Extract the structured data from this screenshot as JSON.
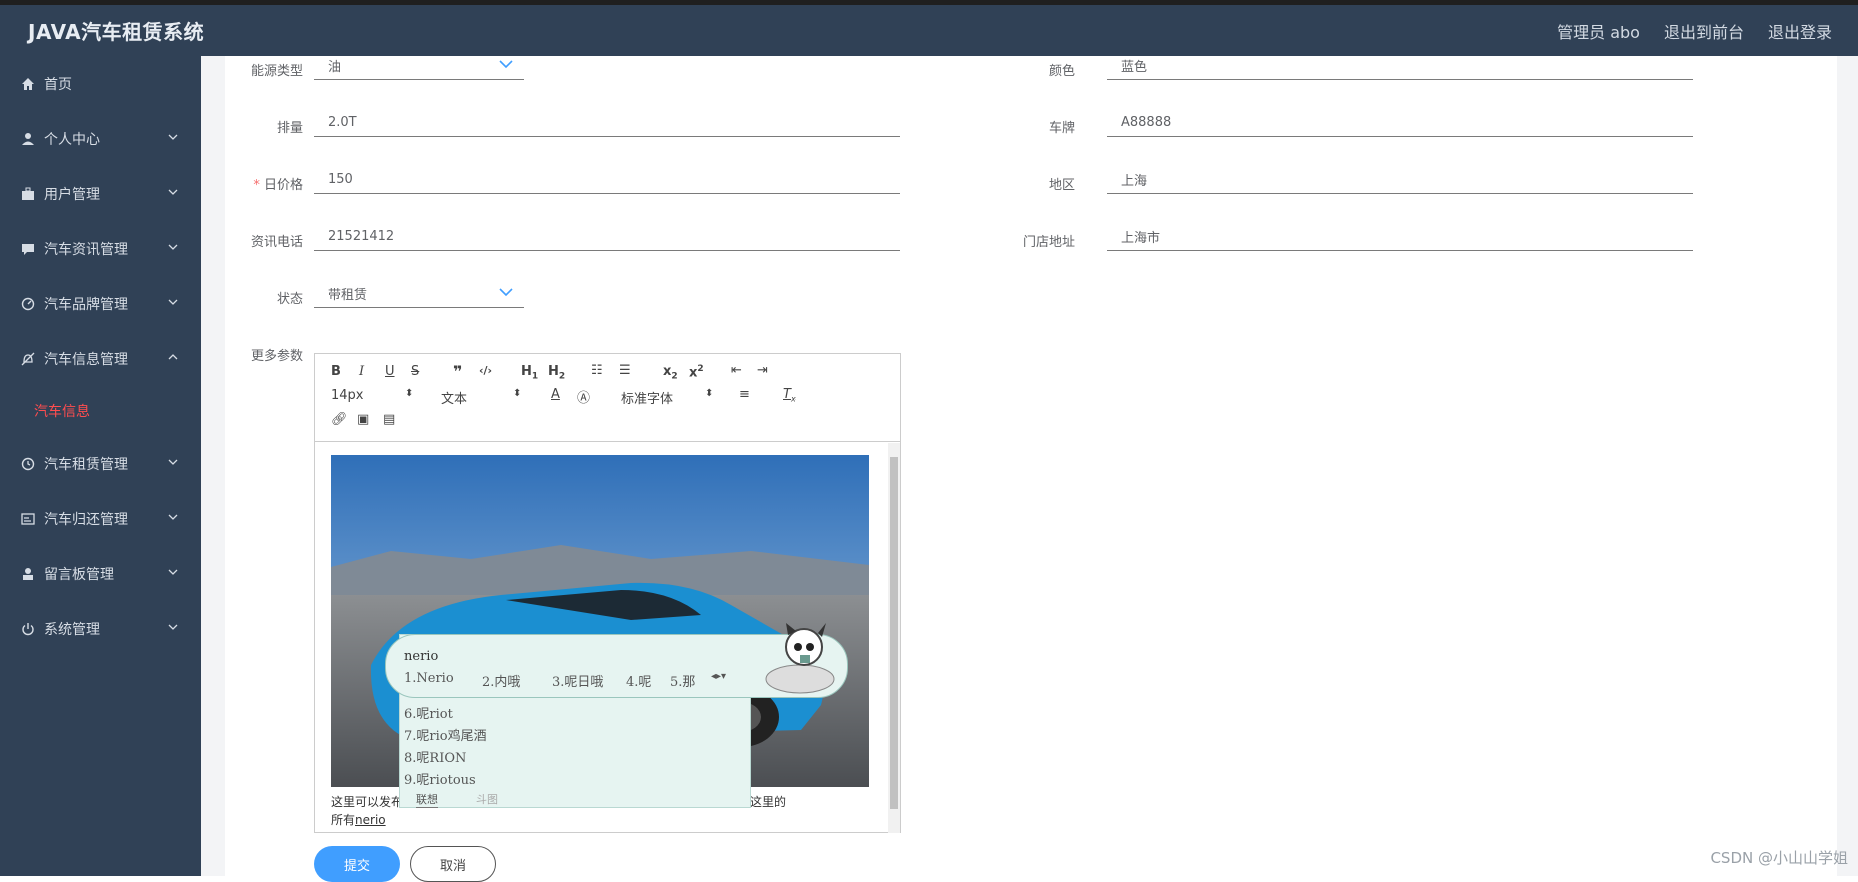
{
  "app": {
    "title": "JAVA汽车租赁系统",
    "header_links": [
      "管理员 abo",
      "退出到前台",
      "退出登录"
    ]
  },
  "sidebar": {
    "items": [
      {
        "label": "首页",
        "icon": "home-icon"
      },
      {
        "label": "个人中心",
        "icon": "user-icon"
      },
      {
        "label": "用户管理",
        "icon": "briefcase-icon"
      },
      {
        "label": "汽车资讯管理",
        "icon": "chat-icon"
      },
      {
        "label": "汽车品牌管理",
        "icon": "gauge-icon"
      },
      {
        "label": "汽车信息管理",
        "icon": "bell-off-icon"
      },
      {
        "label": "汽车租赁管理",
        "icon": "clock-icon"
      },
      {
        "label": "汽车归还管理",
        "icon": "card-icon"
      },
      {
        "label": "留言板管理",
        "icon": "person-icon"
      },
      {
        "label": "系统管理",
        "icon": "power-icon"
      }
    ],
    "active_submenu": "汽车信息"
  },
  "form": {
    "energy_label": "能源类型",
    "energy_value": "油",
    "color_label": "颜色",
    "color_value": "蓝色",
    "displacement_label": "排量",
    "displacement_value": "2.0T",
    "plate_label": "车牌",
    "plate_value": "A88888",
    "price_label": "日价格",
    "price_required": "*",
    "price_value": "150",
    "region_label": "地区",
    "region_value": "上海",
    "phone_label": "资讯电话",
    "phone_value": "21521412",
    "store_label": "门店地址",
    "store_value": "上海市",
    "status_label": "状态",
    "status_value": "带租赁",
    "more_label": "更多参数"
  },
  "editor": {
    "font_size": "14px",
    "paragraph": "文本",
    "font_family": "标准字体",
    "body_line1": "这里可以发布",
    "body_line1_end": "适合描述的，这里的",
    "body_line2": "所有",
    "body_typed": "nerio"
  },
  "ime": {
    "input": "nerio",
    "candidates_row": [
      "1.Nerio",
      "2.内哦",
      "3.呢日哦",
      "4.呢",
      "5.那"
    ],
    "candidates_list": [
      "6.呢riot",
      "7.呢rio鸡尾酒",
      "8.呢RION",
      "9.呢riotous"
    ],
    "tabs": [
      "联想",
      "斗图"
    ]
  },
  "actions": {
    "submit": "提交",
    "cancel": "取消"
  },
  "watermark": "CSDN @小山山学姐",
  "colors": {
    "sidebar": "#304156",
    "primary": "#409eff",
    "active": "#ff4d4f"
  }
}
